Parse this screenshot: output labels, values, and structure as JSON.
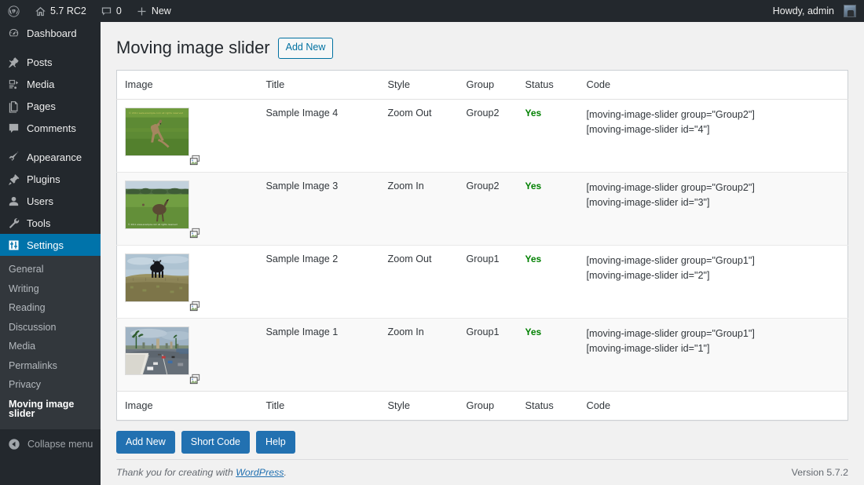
{
  "adminbar": {
    "logo_icon": "wordpress-logo-icon",
    "site_item": {
      "icon": "home-icon",
      "label": "5.7 RC2"
    },
    "comments_item": {
      "icon": "comment-bubble-icon",
      "count": "0"
    },
    "new_item": {
      "icon": "plus-icon",
      "label": "New"
    },
    "account": {
      "greeting": "Howdy, admin",
      "avatar": "user-avatar"
    }
  },
  "sidebar": {
    "items": [
      {
        "label": "Dashboard",
        "icon": "dashboard-icon",
        "current": false,
        "sep_after": true
      },
      {
        "label": "Posts",
        "icon": "pin-icon",
        "current": false,
        "sep_after": false
      },
      {
        "label": "Media",
        "icon": "media-icon",
        "current": false,
        "sep_after": false
      },
      {
        "label": "Pages",
        "icon": "pages-icon",
        "current": false,
        "sep_after": false
      },
      {
        "label": "Comments",
        "icon": "comment-bubble-icon",
        "current": false,
        "sep_after": true
      },
      {
        "label": "Appearance",
        "icon": "paintbrush-icon",
        "current": false,
        "sep_after": false
      },
      {
        "label": "Plugins",
        "icon": "plugins-icon",
        "current": false,
        "sep_after": false
      },
      {
        "label": "Users",
        "icon": "user-icon",
        "current": false,
        "sep_after": false
      },
      {
        "label": "Tools",
        "icon": "wrench-icon",
        "current": false,
        "sep_after": false
      },
      {
        "label": "Settings",
        "icon": "settings-sliders-icon",
        "current": true,
        "sep_after": false
      }
    ],
    "submenu": [
      {
        "label": "General",
        "current": false
      },
      {
        "label": "Writing",
        "current": false
      },
      {
        "label": "Reading",
        "current": false
      },
      {
        "label": "Discussion",
        "current": false
      },
      {
        "label": "Media",
        "current": false
      },
      {
        "label": "Permalinks",
        "current": false
      },
      {
        "label": "Privacy",
        "current": false
      },
      {
        "label": "Moving image slider",
        "current": true
      }
    ],
    "collapse": {
      "label": "Collapse menu",
      "icon": "collapse-arrow-icon"
    },
    "accent_color": "#0073aa",
    "background_color": "#23282d"
  },
  "page": {
    "title": "Moving image slider",
    "add_new_label": "Add New"
  },
  "table": {
    "columns": [
      "Image",
      "Title",
      "Style",
      "Group",
      "Status",
      "Code"
    ],
    "rows": [
      {
        "image_alt": "kangaroo-on-grass",
        "image_scene": "kangaroo",
        "title": "Sample Image 4",
        "style": "Zoom Out",
        "group": "Group2",
        "status": "Yes",
        "code": [
          "[moving-image-slider group=\"Group2\"]",
          "[moving-image-slider id=\"4\"]"
        ],
        "duplicate_icon": "duplicate-image-icon"
      },
      {
        "image_alt": "emu-in-field",
        "image_scene": "emu",
        "title": "Sample Image 3",
        "style": "Zoom In",
        "group": "Group2",
        "status": "Yes",
        "code": [
          "[moving-image-slider group=\"Group2\"]",
          "[moving-image-slider id=\"3\"]"
        ],
        "duplicate_icon": "duplicate-image-icon"
      },
      {
        "image_alt": "cow-on-hill",
        "image_scene": "cow",
        "title": "Sample Image 2",
        "style": "Zoom Out",
        "group": "Group1",
        "status": "Yes",
        "code": [
          "[moving-image-slider group=\"Group1\"]",
          "[moving-image-slider id=\"2\"]"
        ],
        "duplicate_icon": "duplicate-image-icon"
      },
      {
        "image_alt": "city-road-with-palm-trees",
        "image_scene": "road",
        "title": "Sample Image 1",
        "style": "Zoom In",
        "group": "Group1",
        "status": "Yes",
        "code": [
          "[moving-image-slider group=\"Group1\"]",
          "[moving-image-slider id=\"1\"]"
        ],
        "duplicate_icon": "duplicate-image-icon"
      }
    ],
    "status_color": "#008000"
  },
  "actions": {
    "add_new": "Add New",
    "short_code": "Short Code",
    "help": "Help"
  },
  "footer": {
    "thanks_prefix": "Thank you for creating with ",
    "thanks_link": "WordPress",
    "thanks_suffix": ".",
    "version": "Version 5.7.2"
  }
}
